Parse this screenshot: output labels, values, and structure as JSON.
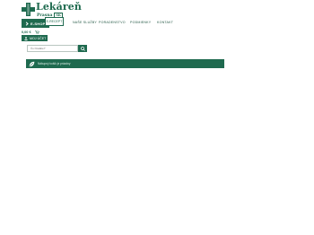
{
  "brand": {
    "title": "Lekáreň",
    "subtitle": "Prasna",
    "subtitle_tag": "SK"
  },
  "nav": {
    "shop_label": "E-SHOP",
    "erecept_label": "E-RECEPT",
    "links": [
      "NAŠE SLUŽBY",
      "PORADENSTVO",
      "PODMIENKY",
      "KONTAKT"
    ]
  },
  "cart": {
    "total": "0,00 €"
  },
  "account": {
    "label": "MOJ ÚČET"
  },
  "search": {
    "placeholder": "Čo hľadáte?"
  },
  "banner": {
    "text": "Nákupný košík je prázdny"
  },
  "colors": {
    "brand_green": "#1f6a4f"
  }
}
